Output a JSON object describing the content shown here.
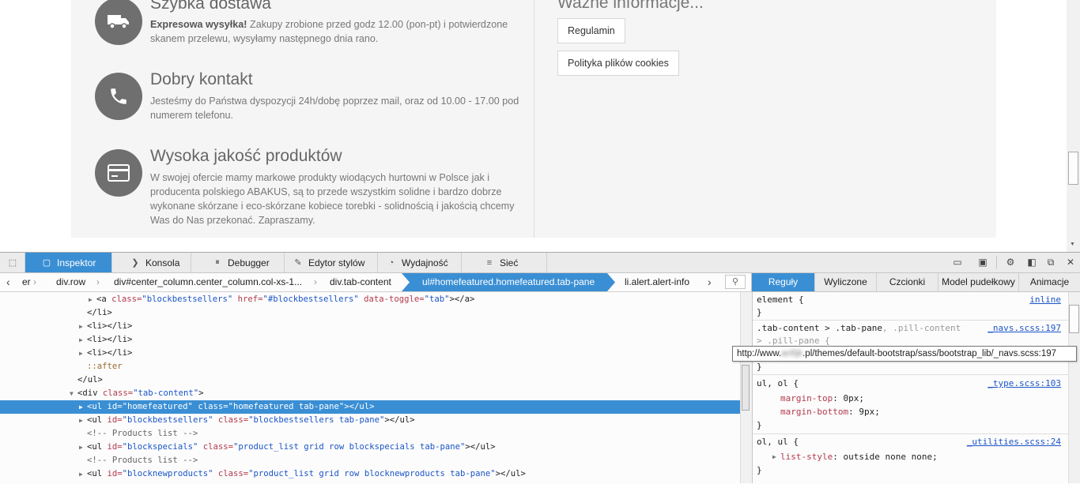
{
  "page": {
    "features": [
      {
        "icon": "truck-icon",
        "title": "Szybka dostawa",
        "lead": "Expresowa wysyłka!",
        "text": " Zakupy zrobione przed godz 12.00 (pon-pt) i potwierdzone skanem przelewu, wysyłamy następnego dnia rano."
      },
      {
        "icon": "phone-icon",
        "title": "Dobry kontakt",
        "text": "Jesteśmy do Państwa dyspozycji 24h/dobę poprzez mail, oraz od 10.00 - 17.00 pod numerem telefonu."
      },
      {
        "icon": "credit-card-icon",
        "title": "Wysoka jakość produktów",
        "text": "W swojej ofercie mamy markowe produkty wiodących hurtowni w Polsce jak i producenta polskiego ABAKUS, są to przede wszystkim solidne i bardzo dobrze wykonane skórzane i eco-skórzane kobiece torebki - solidnością i jakością chcemy Was do Nas przekonać. Zapraszamy."
      }
    ],
    "side_title": "Ważne informacje...",
    "buttons": [
      "Regulamin",
      "Polityka plików cookies"
    ]
  },
  "devtools": {
    "toolbar": [
      {
        "label": "Inspektor",
        "icon": "inspector-icon",
        "active": true
      },
      {
        "label": "Konsola",
        "icon": "console-icon"
      },
      {
        "label": "Debugger",
        "icon": "debugger-icon"
      },
      {
        "label": "Edytor stylów",
        "icon": "style-editor-icon"
      },
      {
        "label": "Wydajność",
        "icon": "performance-icon"
      },
      {
        "label": "Sieć",
        "icon": "network-icon"
      }
    ],
    "breadcrumbs": [
      "er",
      "div.row",
      "div#center_column.center_column.col-xs-1...",
      "div.tab-content",
      "ul#homefeatured.homefeatured.tab-pane",
      "li.alert.alert-info"
    ],
    "side_tabs": [
      "Reguły",
      "Wyliczone",
      "Czcionki",
      "Model pudełkowy",
      "Animacje"
    ],
    "markup": {
      "l1_tag_open": "<a ",
      "l1_a1": "class=",
      "l1_v1": "\"blockbestsellers\"",
      "l1_a2": " href=",
      "l1_v2": "\"#blockbestsellers\"",
      "l1_a3": " data-toggle=",
      "l1_v3": "\"tab\"",
      "l1_tag_close": "></a>",
      "l2": "</li>",
      "l3": "<li></li>",
      "l6": "::after",
      "l7": "</ul>",
      "l8_tag": "<div ",
      "l8_a": "class=",
      "l8_v": "\"tab-content\"",
      "l8_end": ">",
      "l9": "<ul id=\"homefeatured\" class=\"homefeatured tab-pane\"></ul>",
      "l10_tag": "<ul ",
      "l10_a1": "id=",
      "l10_v1": "\"blockbestsellers\"",
      "l10_a2": " class=",
      "l10_v2": "\"blockbestsellers tab-pane\"",
      "l10_end": "></ul>",
      "l11": "<!-- Products list -->",
      "l12_tag": "<ul ",
      "l12_a1": "id=",
      "l12_v1": "\"blockspecials\"",
      "l12_a2": " class=",
      "l12_v2": "\"product_list grid row blockspecials tab-pane\"",
      "l12_end": "></ul>",
      "l13": "<!-- Products list -->",
      "l14_tag": "<ul ",
      "l14_a1": "id=",
      "l14_v1": "\"blocknewproducts\"",
      "l14_a2": " class=",
      "l14_v2": "\"product_list grid row blocknewproducts tab-pane\"",
      "l14_end": "></ul>"
    },
    "rules": {
      "r1_sel": "element {",
      "r1_src": "inline",
      "r1_close": "}",
      "r2_sel_a": ".tab-content > .tab-pane",
      "r2_sel_b": ", .pill-content",
      "r2_src": "_navs.scss:197",
      "r2_sel_c": "> .pill-pane {",
      "r2_close": "}",
      "r3_sel": "ul, ol {",
      "r3_src": "_type.scss:103",
      "r3_p1": "margin-top",
      "r3_v1": "0px;",
      "r3_p2": "margin-bottom",
      "r3_v2": "9px;",
      "r3_close": "}",
      "r4_sel": "ol, ul {",
      "r4_src": "_utilities.scss:24",
      "r4_p1": "list-style",
      "r4_v1": "outside none none;",
      "r4_close": "}"
    },
    "tooltip": {
      "prefix": "http://www.",
      "blur": "anfijk",
      "suffix": ".pl/themes/default-bootstrap/sass/bootstrap_lib/_navs.scss:197"
    }
  },
  "colors": {
    "accent": "#3a8fd4",
    "icon_bg": "#6f6f6f"
  }
}
